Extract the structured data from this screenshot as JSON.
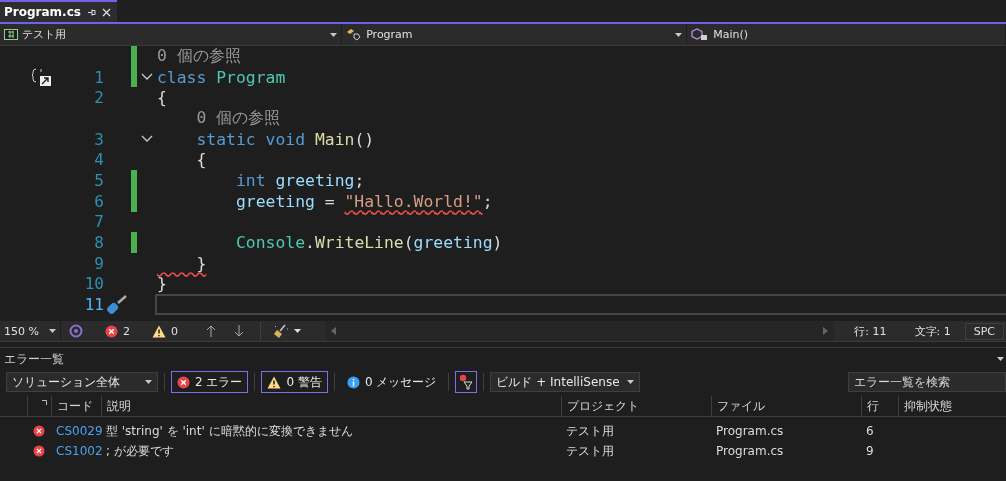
{
  "tab": {
    "title": "Program.cs",
    "selected": true
  },
  "nav": {
    "project": "テスト用",
    "type": "Program",
    "member": "Main()"
  },
  "lines": [
    {
      "kind": "lens",
      "text": "0 個の参照",
      "changed": true
    },
    {
      "kind": "code",
      "number": "1",
      "changed": true,
      "fold": true,
      "marker": {
        "kind": "braces"
      },
      "current": false,
      "tokens": [
        {
          "text": "class ",
          "kind": "keyword",
          "squiggle": false
        },
        {
          "text": "Program",
          "kind": "type",
          "squiggle": false
        }
      ]
    },
    {
      "kind": "code",
      "number": "2",
      "changed": false,
      "fold": false,
      "current": false,
      "tokens": [
        {
          "text": "{",
          "kind": "plain",
          "squiggle": false
        }
      ]
    },
    {
      "kind": "lens",
      "text": "    0 個の参照",
      "changed": false
    },
    {
      "kind": "code",
      "number": "3",
      "changed": false,
      "fold": true,
      "current": false,
      "tokens": [
        {
          "text": "    static void ",
          "kind": "keyword",
          "squiggle": false
        },
        {
          "text": "Main",
          "kind": "method",
          "squiggle": false
        },
        {
          "text": "()",
          "kind": "plain",
          "squiggle": false
        }
      ]
    },
    {
      "kind": "code",
      "number": "4",
      "changed": false,
      "fold": false,
      "current": false,
      "tokens": [
        {
          "text": "    {",
          "kind": "plain",
          "squiggle": false
        }
      ]
    },
    {
      "kind": "code",
      "number": "5",
      "changed": true,
      "fold": false,
      "current": false,
      "tokens": [
        {
          "text": "        int ",
          "kind": "keyword",
          "squiggle": false
        },
        {
          "text": "greeting",
          "kind": "var",
          "squiggle": false
        },
        {
          "text": ";",
          "kind": "plain",
          "squiggle": false
        }
      ]
    },
    {
      "kind": "code",
      "number": "6",
      "changed": true,
      "fold": false,
      "current": false,
      "tokens": [
        {
          "text": "        greeting",
          "kind": "var",
          "squiggle": false
        },
        {
          "text": " = ",
          "kind": "plain",
          "squiggle": false
        },
        {
          "text": "\"Hallo.World!\"",
          "kind": "string",
          "squiggle": true
        },
        {
          "text": ";",
          "kind": "plain",
          "squiggle": false
        }
      ]
    },
    {
      "kind": "code",
      "number": "7",
      "changed": false,
      "fold": false,
      "current": false
    },
    {
      "kind": "code",
      "number": "8",
      "changed": true,
      "fold": false,
      "current": false,
      "tokens": [
        {
          "text": "        Console",
          "kind": "type",
          "squiggle": false
        },
        {
          "text": ".",
          "kind": "plain",
          "squiggle": false
        },
        {
          "text": "WriteLine",
          "kind": "method",
          "squiggle": false
        },
        {
          "text": "(",
          "kind": "plain",
          "squiggle": false
        },
        {
          "text": "greeting",
          "kind": "var",
          "squiggle": false
        },
        {
          "text": ")",
          "kind": "plain",
          "squiggle": false
        }
      ]
    },
    {
      "kind": "code",
      "number": "9",
      "changed": false,
      "fold": false,
      "current": false,
      "tokens": [
        {
          "text": "    }",
          "kind": "plain",
          "squiggle": true
        }
      ]
    },
    {
      "kind": "code",
      "number": "10",
      "changed": false,
      "fold": false,
      "current": false,
      "tokens": [
        {
          "text": "}",
          "kind": "plain",
          "squiggle": false
        }
      ]
    },
    {
      "kind": "code",
      "number": "11",
      "changed": false,
      "fold": false,
      "marker": {
        "kind": "screwdriver"
      },
      "current": true
    }
  ],
  "status": {
    "zoom": "150 %",
    "errors": "2",
    "warnings": "0",
    "line": "行: 11",
    "column": "文字: 1",
    "mode": "SPC"
  },
  "error_list": {
    "title": "エラー一覧",
    "scope": "ソリューション全体",
    "filters": [
      {
        "kind": "error",
        "label": "2 エラー",
        "selected": true
      },
      {
        "kind": "warning",
        "label": "0 警告",
        "selected": true
      },
      {
        "kind": "info",
        "label": "0 メッセージ",
        "selected": false
      }
    ],
    "filter_toggle": {
      "selected": true
    },
    "source": "ビルド + IntelliSense",
    "search": {
      "placeholder": "エラー一覧を検索"
    },
    "columns": [
      "コード",
      "説明",
      "プロジェクト",
      "ファイル",
      "行",
      "抑制状態"
    ],
    "rows": [
      {
        "code": "CS0029",
        "description": "型 'string' を 'int' に暗黙的に変換できません",
        "project": "テスト用",
        "file": "Program.cs",
        "line": "6"
      },
      {
        "code": "CS1002",
        "description": "; が必要です",
        "project": "テスト用",
        "file": "Program.cs",
        "line": "9"
      }
    ]
  }
}
